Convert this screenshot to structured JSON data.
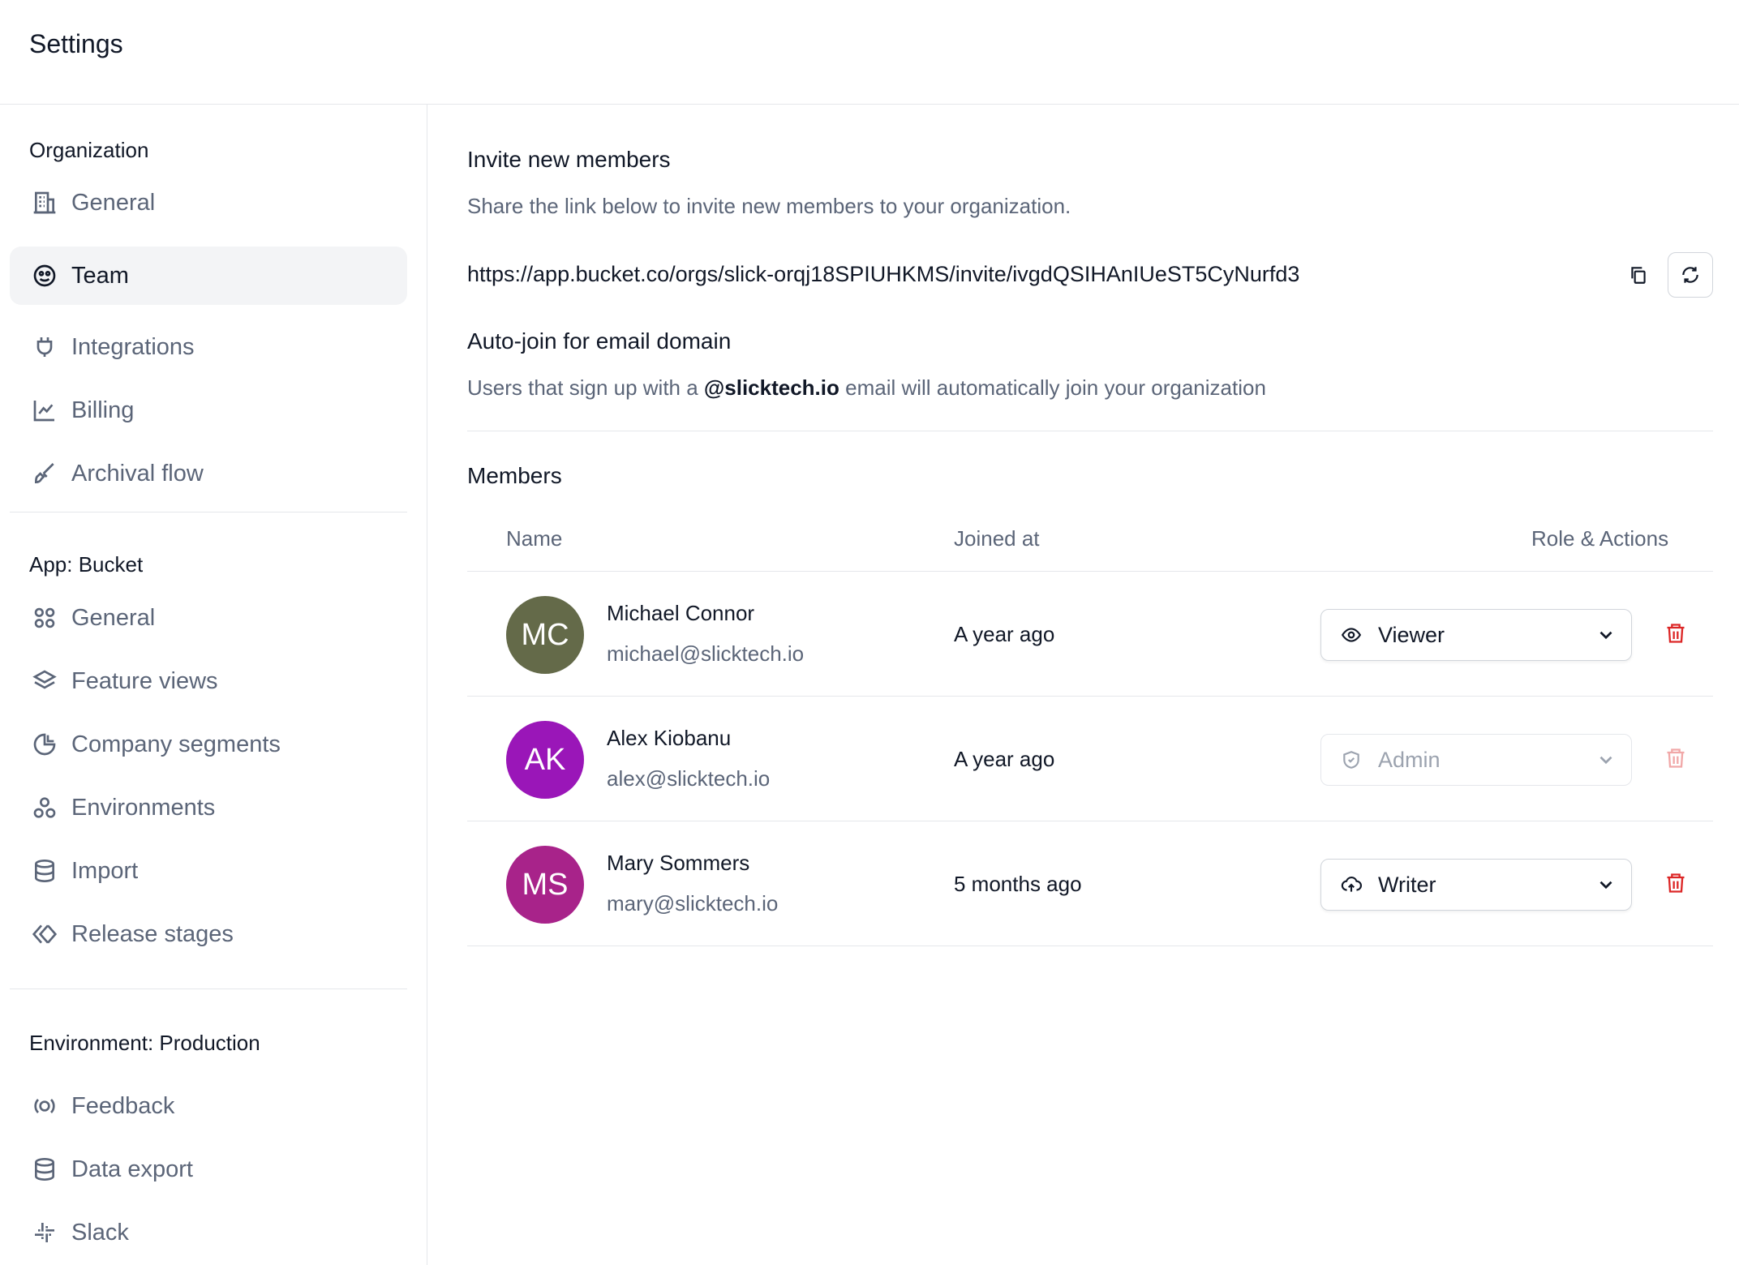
{
  "header": {
    "title": "Settings"
  },
  "sidebar": {
    "sections": [
      {
        "title": "Organization",
        "items": [
          {
            "label": "General",
            "icon": "building-icon",
            "active": false
          },
          {
            "label": "Team",
            "icon": "team-face-icon",
            "active": true
          },
          {
            "label": "Integrations",
            "icon": "plug-icon",
            "active": false
          },
          {
            "label": "Billing",
            "icon": "line-chart-icon",
            "active": false
          },
          {
            "label": "Archival flow",
            "icon": "brush-icon",
            "active": false
          }
        ]
      },
      {
        "title": "App: Bucket",
        "items": [
          {
            "label": "General",
            "icon": "grid-circles-icon",
            "active": false
          },
          {
            "label": "Feature views",
            "icon": "layers-icon",
            "active": false
          },
          {
            "label": "Company segments",
            "icon": "pie-chart-icon",
            "active": false
          },
          {
            "label": "Environments",
            "icon": "circles-icon",
            "active": false
          },
          {
            "label": "Import",
            "icon": "database-icon",
            "active": false
          },
          {
            "label": "Release stages",
            "icon": "diamond-arrows-icon",
            "active": false
          }
        ]
      },
      {
        "title": "Environment: Production",
        "items": [
          {
            "label": "Feedback",
            "icon": "broadcast-icon",
            "active": false
          },
          {
            "label": "Data export",
            "icon": "database-icon",
            "active": false
          },
          {
            "label": "Slack",
            "icon": "slack-icon",
            "active": false
          }
        ]
      }
    ]
  },
  "invite": {
    "title": "Invite new members",
    "description": "Share the link below to invite new members to your organization.",
    "link": "https://app.bucket.co/orgs/slick-orqj18SPIUHKMS/invite/ivgdQSIHAnIUeST5CyNurfd3",
    "copy_icon": "copy-icon",
    "refresh_icon": "refresh-icon"
  },
  "autojoin": {
    "title": "Auto-join for email domain",
    "text_before": "Users that sign up with a ",
    "domain": "@slicktech.io",
    "text_after": " email will automatically join your organization"
  },
  "members": {
    "title": "Members",
    "columns": {
      "name": "Name",
      "joined": "Joined at",
      "role": "Role & Actions"
    },
    "rows": [
      {
        "initials": "MC",
        "avatar_color": "#646a49",
        "name": "Michael Connor",
        "email": "michael@slicktech.io",
        "joined": "A year ago",
        "role": "Viewer",
        "role_icon": "eye-icon",
        "disabled": false
      },
      {
        "initials": "AK",
        "avatar_color": "#9a16b8",
        "name": "Alex Kiobanu",
        "email": "alex@slicktech.io",
        "joined": "A year ago",
        "role": "Admin",
        "role_icon": "shield-check-icon",
        "disabled": true
      },
      {
        "initials": "MS",
        "avatar_color": "#a8238a",
        "name": "Mary Sommers",
        "email": "mary@slicktech.io",
        "joined": "5 months ago",
        "role": "Writer",
        "role_icon": "cloud-upload-icon",
        "disabled": false
      }
    ]
  },
  "colors": {
    "danger": "#dc2626",
    "muted": "#5b6578",
    "border": "#e5e7eb"
  }
}
